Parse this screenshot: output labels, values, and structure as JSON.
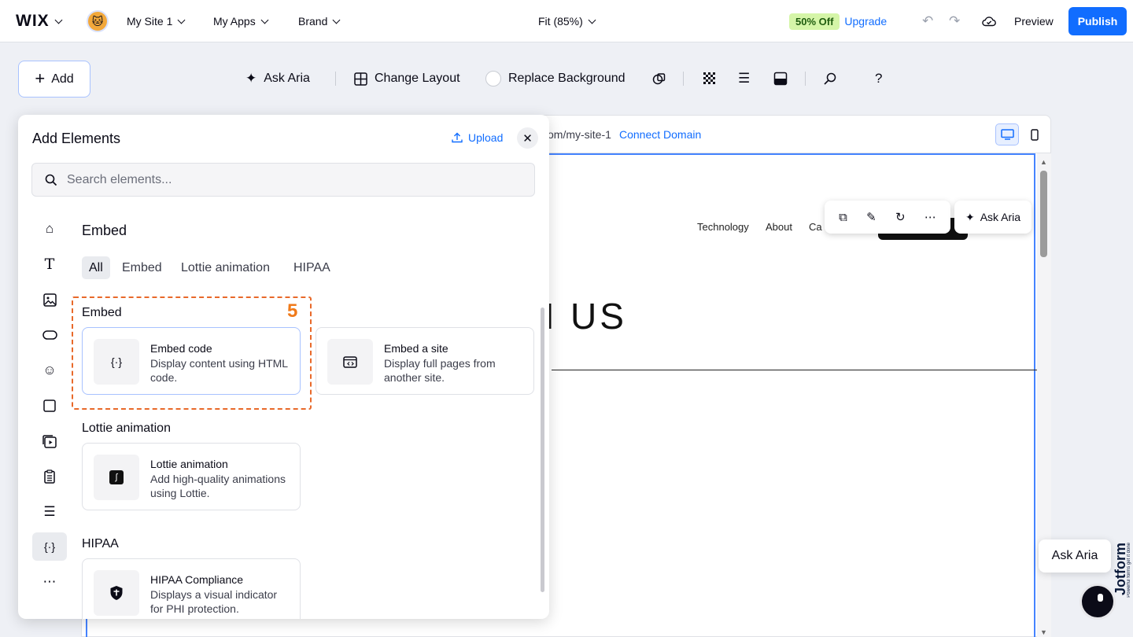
{
  "topbar": {
    "logo": "WIX",
    "site_name": "My Site 1",
    "my_apps": "My Apps",
    "brand": "Brand",
    "zoom": "Fit (85%)",
    "promo": "50% Off",
    "upgrade": "Upgrade",
    "preview": "Preview",
    "publish": "Publish"
  },
  "toolbar": {
    "add": "Add",
    "ask_aria": "Ask Aria",
    "change_layout": "Change Layout",
    "replace_background": "Replace Background"
  },
  "canvas": {
    "url_partial": "om/my-site-1",
    "connect_domain": "Connect Domain",
    "nav": [
      "Technology",
      "About",
      "Ca"
    ],
    "hero_partial": "N US",
    "float_ask_aria": "Ask Aria"
  },
  "panel": {
    "title": "Add Elements",
    "upload": "Upload",
    "search_placeholder": "Search elements...",
    "section_heading": "Embed",
    "filters": [
      "All",
      "Embed",
      "Lottie animation",
      "HIPAA"
    ],
    "groups": [
      {
        "label": "Embed",
        "items": [
          {
            "title": "Embed code",
            "desc": "Display content using HTML code."
          },
          {
            "title": "Embed a site",
            "desc": "Display full pages from another site."
          }
        ]
      },
      {
        "label": "Lottie animation",
        "items": [
          {
            "title": "Lottie animation",
            "desc": "Add high-quality animations using Lottie."
          }
        ]
      },
      {
        "label": "HIPAA",
        "items": [
          {
            "title": "HIPAA Compliance",
            "desc": "Displays a visual indicator for PHI protection."
          }
        ]
      }
    ],
    "annotation_step": "5"
  },
  "help": {
    "ask_aria": "Ask Aria",
    "jotform": "Jotform",
    "jotform_tagline": "Powerful forms get it done"
  },
  "colors": {
    "accent": "#116dff",
    "highlight": "#e8692a",
    "promo_bg": "#d5f5a8"
  }
}
